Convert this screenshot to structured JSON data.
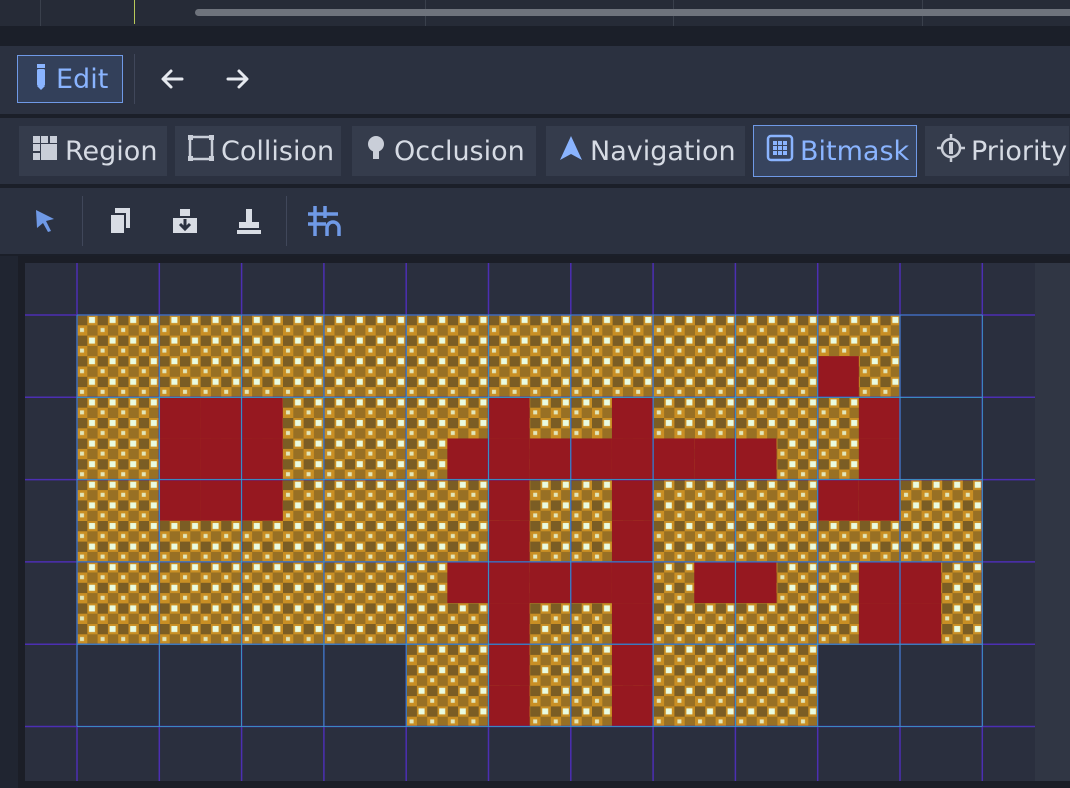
{
  "top_bar": {
    "timeline": "scroll-track"
  },
  "toolbar": {
    "edit_label": "Edit",
    "back_icon": "arrow-left-icon",
    "forward_icon": "arrow-right-icon"
  },
  "tabs": [
    {
      "label": "Region",
      "icon": "region-icon",
      "active": false
    },
    {
      "label": "Collision",
      "icon": "collision-icon",
      "active": false
    },
    {
      "label": "Occlusion",
      "icon": "occlusion-icon",
      "active": false
    },
    {
      "label": "Navigation",
      "icon": "navigation-icon",
      "active": false
    },
    {
      "label": "Bitmask",
      "icon": "bitmask-icon",
      "active": true
    },
    {
      "label": "Priority",
      "icon": "priority-icon",
      "active": false
    }
  ],
  "tools": [
    {
      "name": "select-tool-icon",
      "active": true
    },
    {
      "name": "copy-bitmask-icon",
      "active": false
    },
    {
      "name": "paste-bitmask-icon",
      "active": false
    },
    {
      "name": "erase-bitmask-icon",
      "active": false
    },
    {
      "name": "grid-snap-icon",
      "active": true
    }
  ],
  "colors": {
    "accent": "#8ab4ff",
    "bitmask_fill": "#961820",
    "grid_major": "#4c2fb3",
    "grid_minor": "#2ec5c8",
    "tile_gold": "#c98f24",
    "tile_dark": "#3b3524",
    "tile_light": "#e9fbe0"
  },
  "tileset": {
    "grid_cols": 12,
    "grid_rows": 6,
    "tiles": [
      [
        1,
        1
      ],
      [
        2,
        1
      ],
      [
        3,
        1
      ],
      [
        4,
        1
      ],
      [
        5,
        1
      ],
      [
        6,
        1
      ],
      [
        7,
        1
      ],
      [
        8,
        1
      ],
      [
        9,
        1
      ],
      [
        10,
        1
      ],
      [
        1,
        2
      ],
      [
        2,
        2
      ],
      [
        3,
        2
      ],
      [
        4,
        2
      ],
      [
        5,
        2
      ],
      [
        6,
        2
      ],
      [
        7,
        2
      ],
      [
        8,
        2
      ],
      [
        9,
        2
      ],
      [
        10,
        2
      ],
      [
        1,
        3
      ],
      [
        2,
        3
      ],
      [
        3,
        3
      ],
      [
        4,
        3
      ],
      [
        5,
        3
      ],
      [
        6,
        3
      ],
      [
        7,
        3
      ],
      [
        8,
        3
      ],
      [
        9,
        3
      ],
      [
        10,
        3
      ],
      [
        11,
        3
      ],
      [
        1,
        4
      ],
      [
        2,
        4
      ],
      [
        3,
        4
      ],
      [
        4,
        4
      ],
      [
        5,
        4
      ],
      [
        6,
        4
      ],
      [
        7,
        4
      ],
      [
        8,
        4
      ],
      [
        9,
        4
      ],
      [
        10,
        4
      ],
      [
        11,
        4
      ],
      [
        5,
        5
      ],
      [
        6,
        5
      ],
      [
        7,
        5
      ],
      [
        8,
        5
      ],
      [
        9,
        5
      ]
    ],
    "bitmask_cells": [
      [
        1.5,
        1.5
      ],
      [
        2,
        1.5
      ],
      [
        2.5,
        1.5
      ],
      [
        1.5,
        2
      ],
      [
        2,
        2
      ],
      [
        2.5,
        2
      ],
      [
        1.5,
        2.5
      ],
      [
        2,
        2.5
      ],
      [
        2.5,
        2.5
      ],
      [
        5.5,
        1.5
      ],
      [
        7,
        1.5
      ],
      [
        5,
        2
      ],
      [
        5.5,
        2
      ],
      [
        6,
        2
      ],
      [
        6.5,
        2
      ],
      [
        7,
        2
      ],
      [
        7.5,
        2
      ],
      [
        8,
        2
      ],
      [
        8.5,
        2
      ],
      [
        10,
        2
      ],
      [
        5.5,
        2.5
      ],
      [
        7,
        2.5
      ],
      [
        9.5,
        2.5
      ],
      [
        10,
        2.5
      ],
      [
        5.5,
        3
      ],
      [
        7,
        3
      ],
      [
        5,
        3.5
      ],
      [
        5.5,
        3.5
      ],
      [
        6,
        3.5
      ],
      [
        6.5,
        3.5
      ],
      [
        7,
        3.5
      ],
      [
        8,
        3.5
      ],
      [
        8.5,
        3.5
      ],
      [
        10,
        3.5
      ],
      [
        10.5,
        3.5
      ],
      [
        5.5,
        4
      ],
      [
        7,
        4
      ],
      [
        10,
        4
      ],
      [
        10.5,
        4
      ],
      [
        5.5,
        4.5
      ],
      [
        7,
        4.5
      ],
      [
        5.5,
        5
      ],
      [
        7,
        5
      ],
      [
        9.5,
        1
      ],
      [
        10,
        1.5
      ]
    ]
  }
}
